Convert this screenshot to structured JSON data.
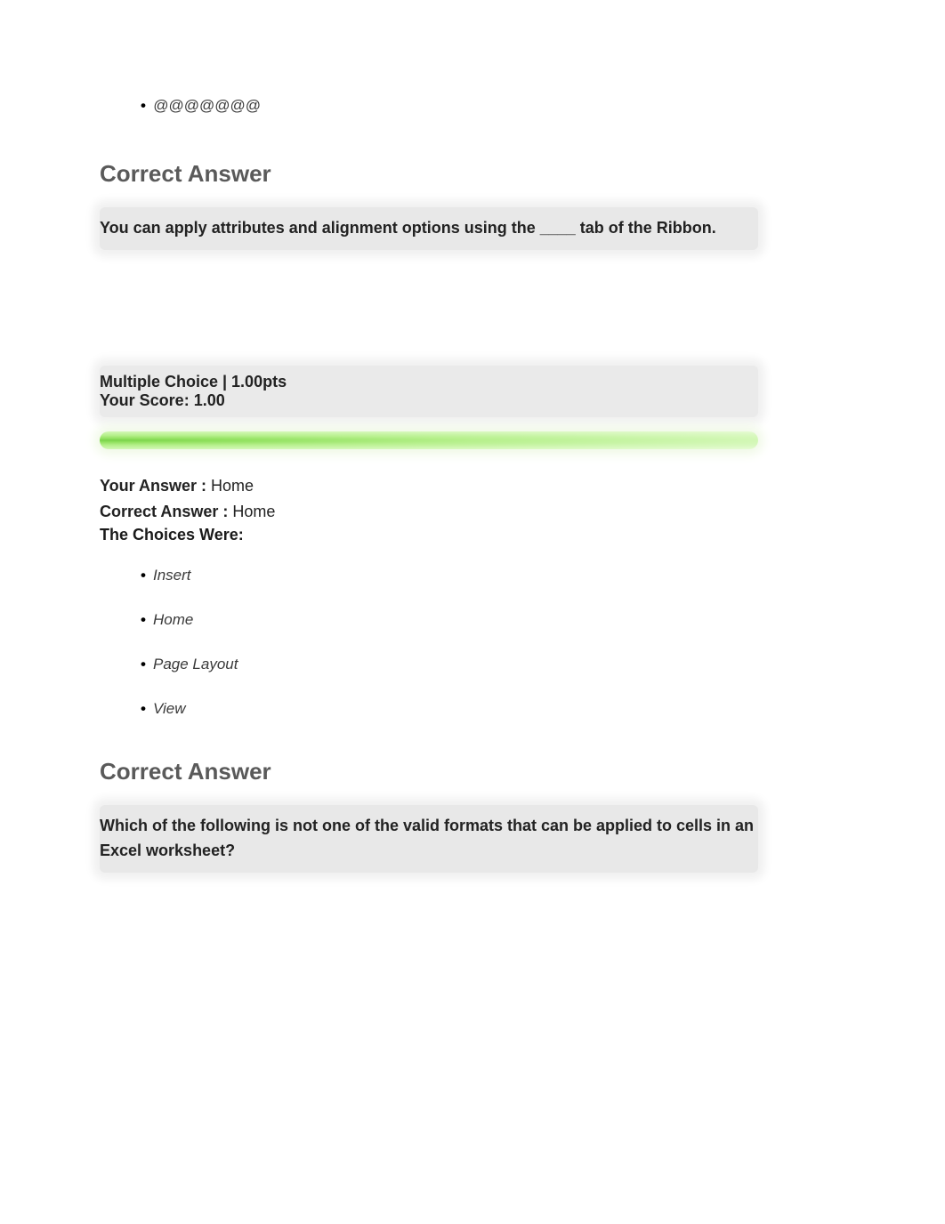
{
  "top_choice_fragment": "@@@@@@@",
  "hidden_row_1": " ",
  "section1": {
    "heading": "Correct Answer",
    "question": "You can apply attributes and alignment options using the ____ tab of the Ribbon."
  },
  "meta": {
    "type_points": "Multiple Choice | 1.00pts",
    "your_score": "Your Score: 1.00"
  },
  "answers": {
    "your_label": "Your Answer :",
    "your_value": " Home",
    "correct_label": "Correct Answer :",
    "correct_value": " Home",
    "choices_heading": "The Choices Were:",
    "choices": [
      "Insert",
      "Home",
      "Page Layout",
      "View"
    ]
  },
  "hidden_row_2": " ",
  "section2": {
    "heading": "Correct Answer",
    "question": "Which of the following is not one of the valid formats that can be applied to cells in an Excel worksheet?"
  }
}
